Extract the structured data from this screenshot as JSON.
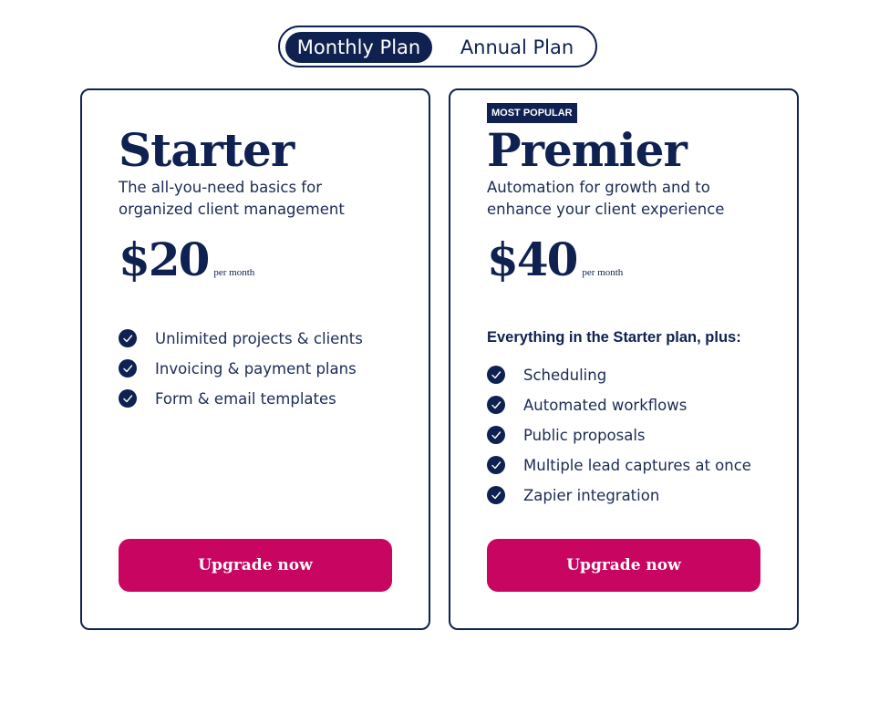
{
  "toggle": {
    "monthly_label": "Monthly Plan",
    "annual_label": "Annual Plan",
    "selected": "Monthly Plan"
  },
  "colors": {
    "navy": "#0f2150",
    "cta": "#c80560",
    "background": "#ffffff"
  },
  "plans": [
    {
      "name": "Starter",
      "description": "The all-you-need basics for organized client management",
      "price": "$20",
      "price_unit": "per month",
      "features": [
        "Unlimited projects & clients",
        "Invoicing & payment plans",
        "Form & email templates"
      ],
      "cta_label": "Upgrade now",
      "icon": "check-circle-icon"
    },
    {
      "badge": "MOST POPULAR",
      "name": "Premier",
      "description": "Automation for growth and to enhance your client experience",
      "price": "$40",
      "price_unit": "per month",
      "features_heading": "Everything in the Starter plan, plus:",
      "features": [
        "Scheduling",
        "Automated workflows",
        "Public proposals",
        "Multiple lead captures at once",
        "Zapier integration"
      ],
      "cta_label": "Upgrade now",
      "icon": "check-circle-icon"
    }
  ]
}
